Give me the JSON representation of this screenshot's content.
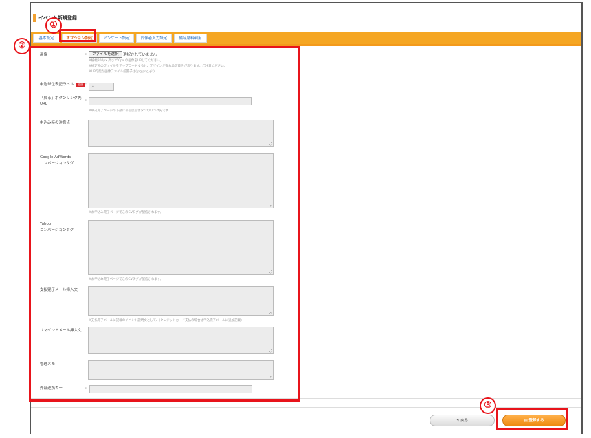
{
  "page": {
    "title": "イベント新規登録"
  },
  "tabs": [
    {
      "label": "基本設定"
    },
    {
      "label": "オプション設定"
    },
    {
      "label": "アンケート設定"
    },
    {
      "label": "同伴者入力設定"
    },
    {
      "label": "備品席料利用"
    }
  ],
  "form": {
    "image": {
      "label": "画像",
      "file_button": "ファイルを選択",
      "file_status": "選択されていません",
      "notes": [
        "※横幅800px 高さ250px の画像をUPしてください。",
        "※規定外のファイルをアップロードすると、デザインが崩れる可能性があります。ご注意ください。",
        "※UP可能な画像ファイル拡張子は(jpg,png,gif)"
      ]
    },
    "unit_label": {
      "label": "申込単位表記ラベル",
      "required": "必須",
      "value": "人"
    },
    "back_button_url": {
      "label_line1": "「戻る」ボタンリンク先",
      "label_line2": "URL",
      "note": "※申込完了ページの下部にある戻るボタンのリンク先です"
    },
    "notes_field": {
      "label": "申込み時の注意点"
    },
    "google_adwords": {
      "label_line1": "Google AdWords",
      "label_line2": "コンバージョンタグ",
      "note": "※お申込み完了ページでこのCVタグが配信されます。"
    },
    "yahoo": {
      "label_line1": "Yahoo",
      "label_line2": "コンバージョンタグ",
      "note": "※お申込み完了ページでこのCVタグが配信されます。"
    },
    "payment_mail": {
      "label": "支払完了メール挿入文",
      "note": "※支払完了メールに記載のイベント説明文として、(クレジットカード支払の場合は申込完了メールに追加記載)"
    },
    "remind_mail": {
      "label": "リマインドメール挿入文"
    },
    "admin_memo": {
      "label": "管理メモ"
    },
    "external_key": {
      "label": "外部連携キー"
    }
  },
  "footer": {
    "back_label": "↰ 戻る",
    "submit_label": "▤ 登録する"
  },
  "annotations": {
    "n1": "①",
    "n2": "②",
    "n3": "③"
  },
  "colors": {
    "accent": "#f5a623",
    "annotation": "#e8141b",
    "link": "#2a6fbe"
  }
}
